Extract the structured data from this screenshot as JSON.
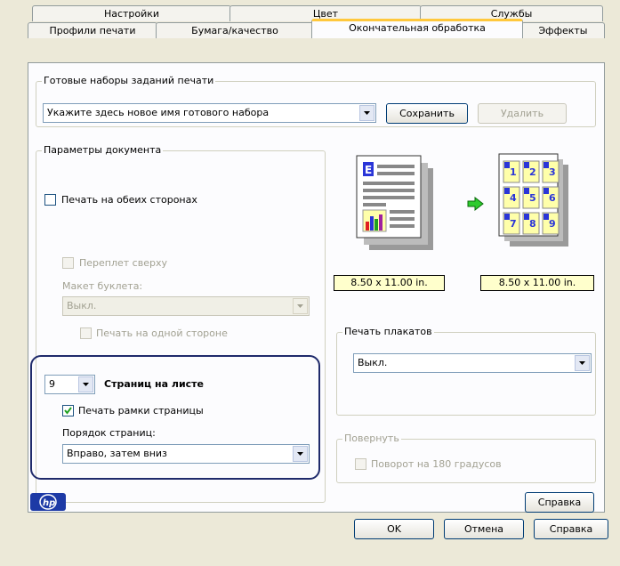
{
  "tabs_row1": [
    "Настройки",
    "Цвет",
    "Службы"
  ],
  "tabs_row2": [
    "Профили печати",
    "Бумага/качество",
    "Окончательная обработка",
    "Эффекты"
  ],
  "presets": {
    "group_title": "Готовые наборы заданий печати",
    "combo_value": "Укажите здесь новое имя готового набора",
    "save": "Сохранить",
    "delete": "Удалить"
  },
  "doc": {
    "group_title": "Параметры документа",
    "duplex": "Печать на обеих сторонах",
    "binding_top": "Переплет сверху",
    "booklet_label": "Макет буклета:",
    "booklet_value": "Выкл.",
    "one_side": "Печать на одной стороне",
    "pages_value": "9",
    "pages_label": "Страниц на листе",
    "borders": "Печать рамки страницы",
    "order_label": "Порядок страниц:",
    "order_value": "Вправо, затем вниз"
  },
  "preview": {
    "size_left": "8.50 x 11.00 in.",
    "size_right": "8.50 x 11.00 in.",
    "page_numbers": [
      "1",
      "2",
      "3",
      "4",
      "5",
      "6",
      "7",
      "8",
      "9"
    ]
  },
  "poster": {
    "group_title": "Печать плакатов",
    "value": "Выкл."
  },
  "rotate": {
    "group_title": "Повернуть",
    "label": "Поворот на 180 градусов"
  },
  "help_inner": "Справка",
  "buttons": {
    "ok": "OK",
    "cancel": "Отмена",
    "help": "Справка"
  },
  "colors": {
    "highlight_ring": "#1f2a6b",
    "active_tab_accent": "#ffc83c",
    "size_label_bg": "#ffffcc"
  }
}
